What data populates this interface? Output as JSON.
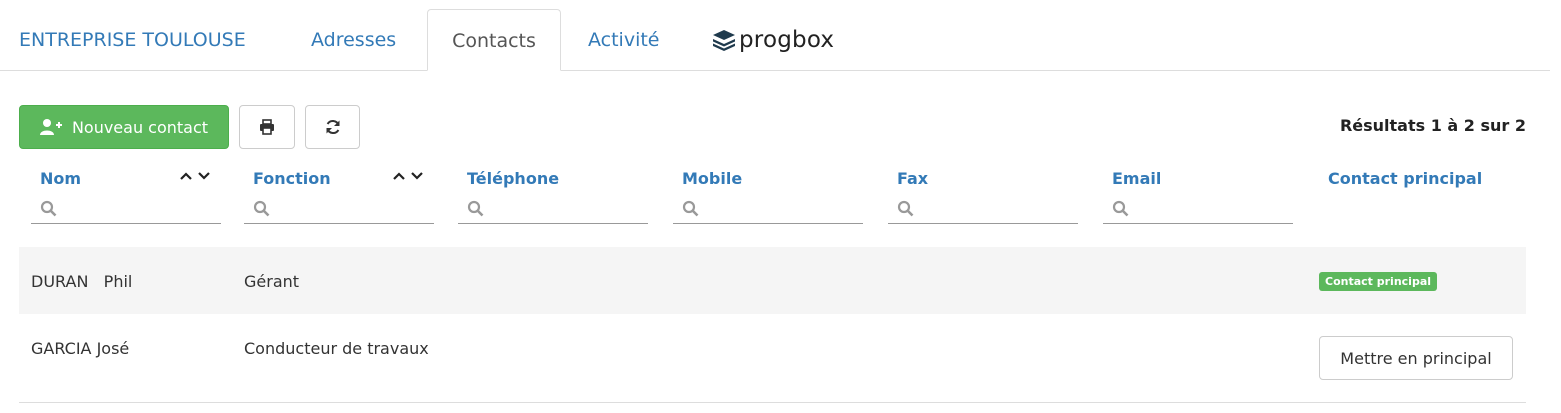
{
  "tabs": {
    "company": "ENTREPRISE TOULOUSE",
    "adresses": "Adresses",
    "contacts": "Contacts",
    "activite": "Activité"
  },
  "logo": {
    "text": "progbox",
    "icon": "stack-layers-icon"
  },
  "toolbar": {
    "new_contact_label": "Nouveau contact",
    "new_contact_icon": "user-plus-icon",
    "print_icon": "print-icon",
    "refresh_icon": "refresh-icon",
    "accent_color": "#5cb85c"
  },
  "results": "Résultats 1 à 2 sur 2",
  "columns": [
    {
      "label": "Nom",
      "sortable": true,
      "filter": true
    },
    {
      "label": "Fonction",
      "sortable": true,
      "filter": true
    },
    {
      "label": "Téléphone",
      "sortable": false,
      "filter": true
    },
    {
      "label": "Mobile",
      "sortable": false,
      "filter": true
    },
    {
      "label": "Fax",
      "sortable": false,
      "filter": true
    },
    {
      "label": "Email",
      "sortable": false,
      "filter": true
    },
    {
      "label": "Contact principal",
      "sortable": false,
      "filter": false
    }
  ],
  "rows": [
    {
      "nom": "DURAN   Phil",
      "fonction": "Gérant",
      "telephone": "",
      "mobile": "",
      "fax": "",
      "email": "",
      "principal_badge": "Contact principal"
    },
    {
      "nom": "GARCIA José",
      "fonction": "Conducteur de travaux",
      "telephone": "",
      "mobile": "",
      "fax": "",
      "email": "",
      "principal_button": "Mettre en principal"
    }
  ]
}
